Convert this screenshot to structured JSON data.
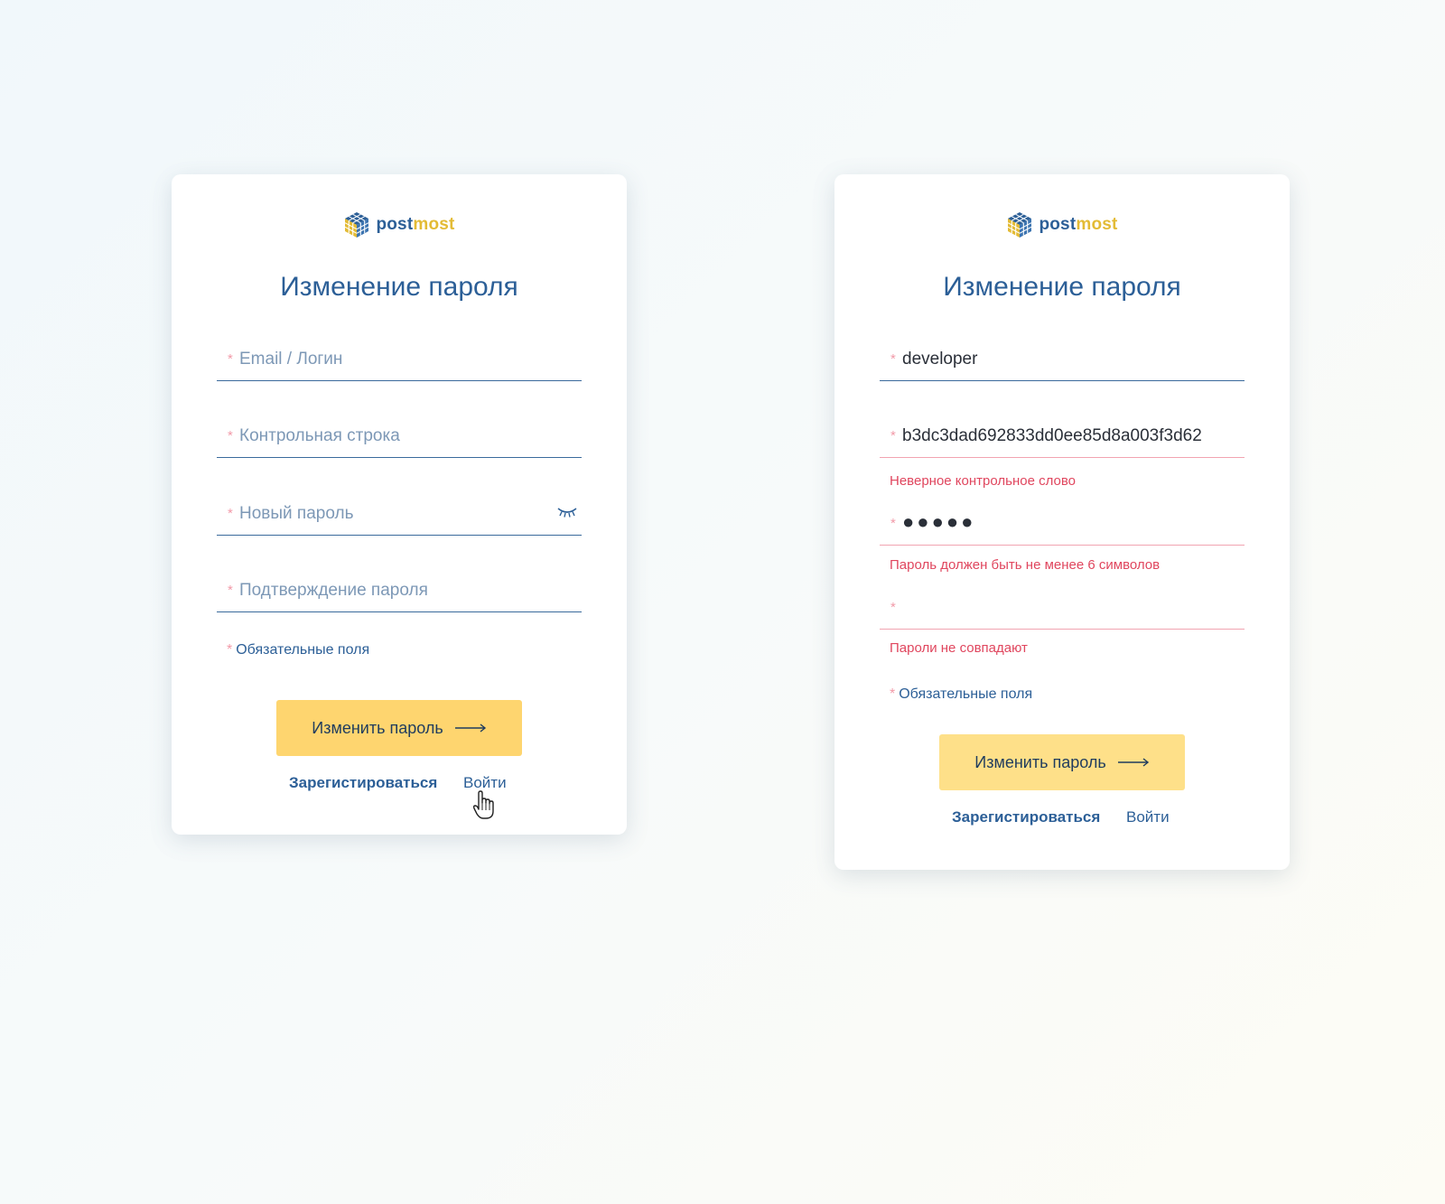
{
  "brand": {
    "part1": "post",
    "part2": "most",
    "colors": {
      "primary": "#2c5f97",
      "accent": "#e3bb35",
      "button": "#fed56f",
      "error": "#e0465e"
    }
  },
  "left_form": {
    "title": "Изменение пароля",
    "fields": [
      {
        "placeholder": "Email / Логин",
        "value": ""
      },
      {
        "placeholder": "Контрольная строка",
        "value": ""
      },
      {
        "placeholder": "Новый пароль",
        "value": "",
        "icon": "eye-closed-icon"
      },
      {
        "placeholder": "Подтверждение пароля",
        "value": ""
      }
    ],
    "required_star": "*",
    "required_note": "Обязательные поля",
    "submit_label": "Изменить пароль",
    "register_link": "Зарегистироваться",
    "login_link": "Войти",
    "cursor": "hand-pointer-icon"
  },
  "right_form": {
    "title": "Изменение пароля",
    "fields": [
      {
        "value": "developer",
        "error": ""
      },
      {
        "value": "b3dc3dad692833dd0ee85d8a003f3d62",
        "error": "Неверное контрольное слово"
      },
      {
        "value": "●●●●●",
        "error": "Пароль должен быть не менее 6 символов"
      },
      {
        "value": "",
        "error": "Пароли не совпадают"
      }
    ],
    "required_star": "*",
    "required_note": "Обязательные поля",
    "submit_label": "Изменить пароль",
    "register_link": "Зарегистироваться",
    "login_link": "Войти"
  }
}
